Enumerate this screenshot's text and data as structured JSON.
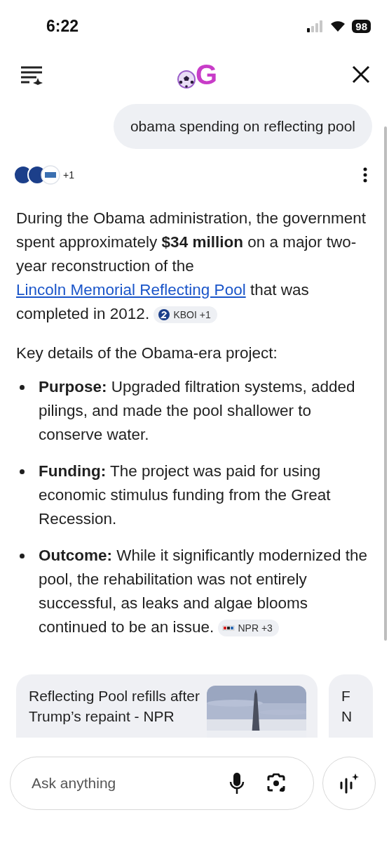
{
  "status_bar": {
    "time": "6:22",
    "battery": "98"
  },
  "header": {
    "logo_letter": "G"
  },
  "query": "obama spending on reflecting pool",
  "sources": {
    "count": "+1"
  },
  "answer": {
    "segments": [
      {
        "kind": "text",
        "text": "During the Obama administration, the government spent approximately **$34 million** on a major two-year reconstruction of the"
      },
      {
        "kind": "link",
        "text": "Lincoln Memorial Reflecting Pool"
      },
      {
        "kind": "text",
        "text": "that was completed in 2012."
      },
      {
        "kind": "chip",
        "source": "KBOI +1"
      }
    ],
    "intro": "Key details of the Obama-era project:",
    "bullets": [
      {
        "text": "**Purpose:** Upgraded filtration systems, added pilings, and made the pool shallower to conserve water."
      },
      {
        "text": "**Funding:** The project was paid for using economic stimulus funding from the Great Recession."
      },
      {
        "text": "**Outcome:** While it significantly modernized the pool, the rehabilitation was not entirely successful, as leaks and algae blooms continued to be an issue.",
        "chip": {
          "source": "NPR +3"
        }
      }
    ]
  },
  "cards": [
    {
      "title_lines": [
        "Reflecting Pool refills after",
        "Trump’s repaint - NPR"
      ],
      "kind": "picture"
    },
    {
      "title_lines": [
        "F",
        "N"
      ]
    }
  ],
  "input": {
    "placeholder": "Ask anything"
  }
}
